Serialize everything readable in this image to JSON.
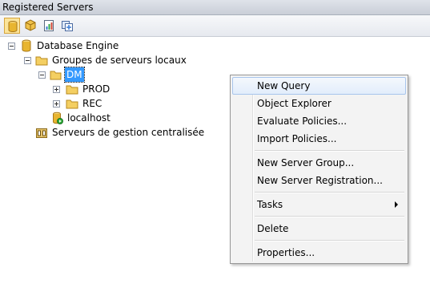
{
  "window": {
    "title": "Registered Servers"
  },
  "toolbar": {
    "buttons": [
      {
        "icon": "database-engine-icon",
        "active": true
      },
      {
        "icon": "analysis-services-icon"
      },
      {
        "icon": "reporting-services-icon"
      },
      {
        "icon": "integration-services-icon"
      }
    ]
  },
  "tree": {
    "root": "Database Engine",
    "local_groups": "Groupes de serveurs locaux",
    "dm": "DM",
    "prod": "PROD",
    "rec": "REC",
    "localhost": "localhost",
    "central": "Serveurs de gestion centralisée"
  },
  "menu": {
    "new_query": "New Query",
    "object_explorer": "Object Explorer",
    "evaluate_policies": "Evaluate Policies...",
    "import_policies": "Import Policies...",
    "new_server_group": "New Server Group...",
    "new_server_registration": "New Server Registration...",
    "tasks": "Tasks",
    "delete": "Delete",
    "properties": "Properties..."
  },
  "colors": {
    "selection": "#3399ff",
    "folder": "#f4cf62",
    "database": "#e8b530",
    "menu_highlight_border": "#a8c5ec"
  }
}
